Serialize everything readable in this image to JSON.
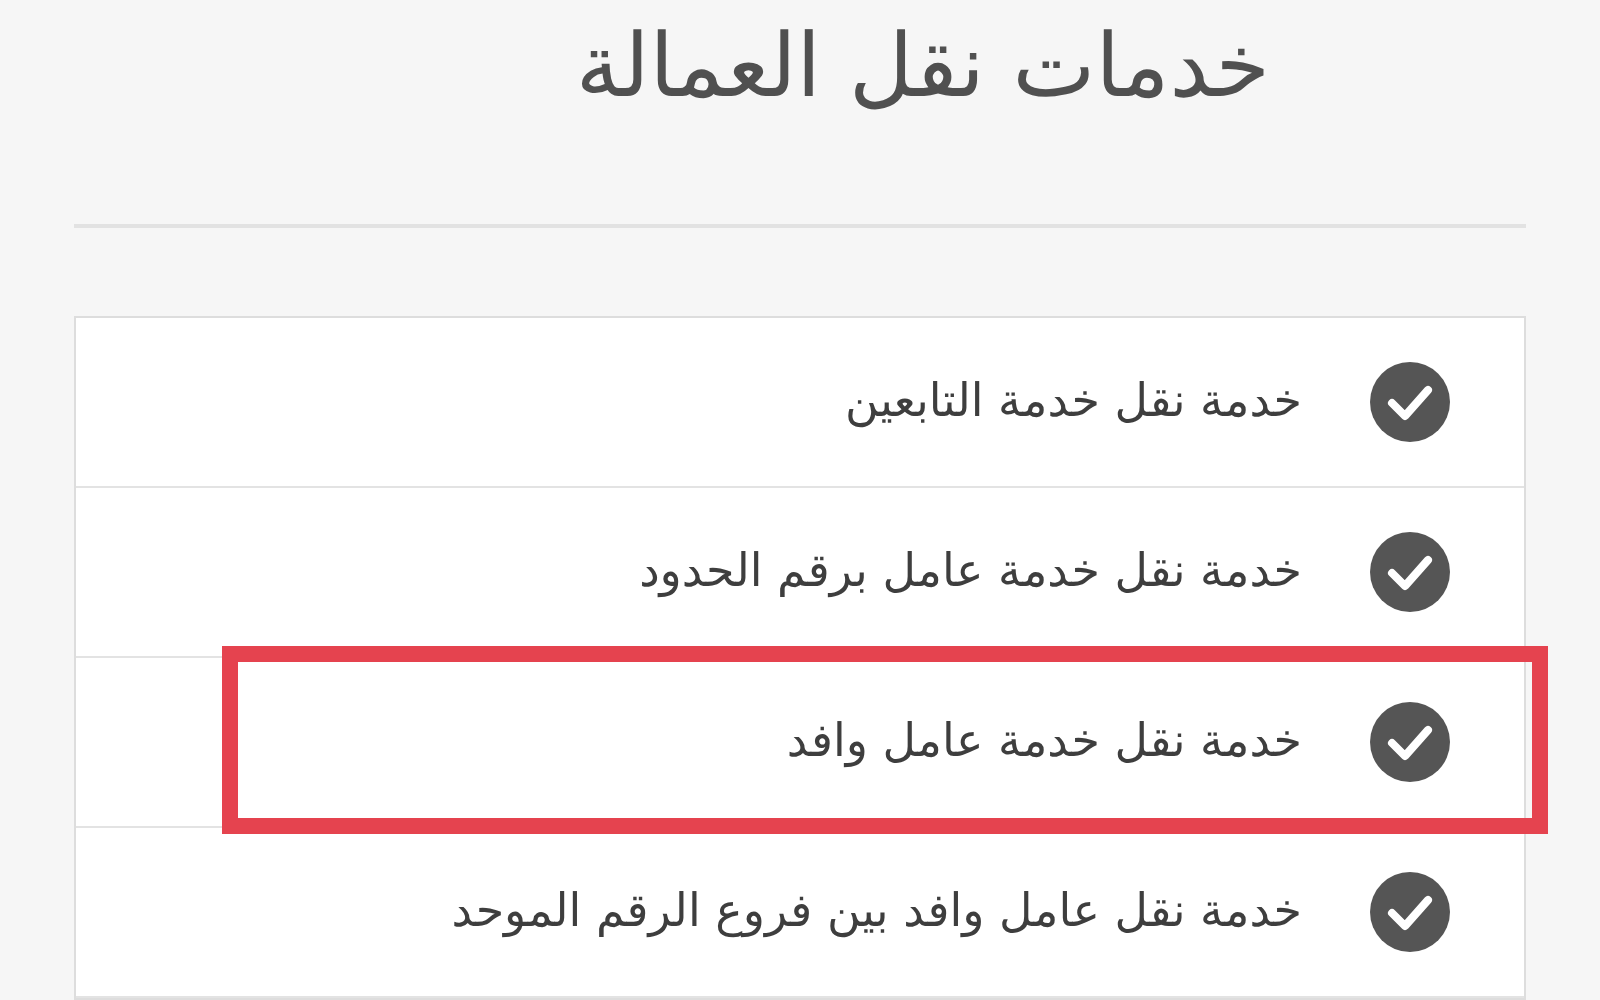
{
  "title": "خدمات نقل العمالة",
  "services": [
    {
      "label": "خدمة نقل خدمة التابعين",
      "highlighted": false
    },
    {
      "label": "خدمة نقل خدمة عامل برقم الحدود",
      "highlighted": false
    },
    {
      "label": "خدمة نقل خدمة عامل وافد",
      "highlighted": true
    },
    {
      "label": "خدمة نقل عامل وافد بين فروع الرقم الموحد",
      "highlighted": false
    }
  ]
}
